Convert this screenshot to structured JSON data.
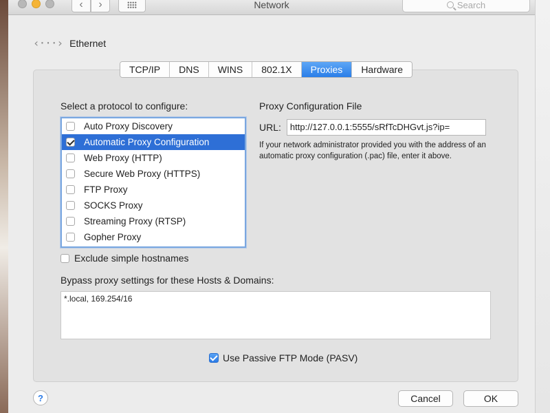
{
  "window": {
    "title": "Network"
  },
  "toolbar": {
    "search_placeholder": "Search"
  },
  "interface": {
    "name": "Ethernet",
    "icon": "ethernet-icon"
  },
  "tabs": [
    {
      "label": "TCP/IP",
      "active": false
    },
    {
      "label": "DNS",
      "active": false
    },
    {
      "label": "WINS",
      "active": false
    },
    {
      "label": "802.1X",
      "active": false
    },
    {
      "label": "Proxies",
      "active": true
    },
    {
      "label": "Hardware",
      "active": false
    }
  ],
  "protocols": {
    "heading": "Select a protocol to configure:",
    "items": [
      {
        "label": "Auto Proxy Discovery",
        "checked": false,
        "selected": false
      },
      {
        "label": "Automatic Proxy Configuration",
        "checked": true,
        "selected": true
      },
      {
        "label": "Web Proxy (HTTP)",
        "checked": false,
        "selected": false
      },
      {
        "label": "Secure Web Proxy (HTTPS)",
        "checked": false,
        "selected": false
      },
      {
        "label": "FTP Proxy",
        "checked": false,
        "selected": false
      },
      {
        "label": "SOCKS Proxy",
        "checked": false,
        "selected": false
      },
      {
        "label": "Streaming Proxy (RTSP)",
        "checked": false,
        "selected": false
      },
      {
        "label": "Gopher Proxy",
        "checked": false,
        "selected": false
      }
    ]
  },
  "exclude_simple": {
    "label": "Exclude simple hostnames",
    "checked": false
  },
  "proxy_file": {
    "heading": "Proxy Configuration File",
    "url_label": "URL:",
    "url_value": "http://127.0.0.1:5555/sRfTcDHGvt.js?ip=",
    "help": "If your network administrator provided you with the address of an automatic proxy configuration (.pac) file, enter it above."
  },
  "bypass": {
    "label": "Bypass proxy settings for these Hosts & Domains:",
    "value": "*.local, 169.254/16"
  },
  "pasv": {
    "label": "Use Passive FTP Mode (PASV)",
    "checked": true
  },
  "buttons": {
    "help": "?",
    "cancel": "Cancel",
    "ok": "OK"
  },
  "colors": {
    "accent": "#2e6fd6",
    "tab_active": "#2a7ee8"
  }
}
